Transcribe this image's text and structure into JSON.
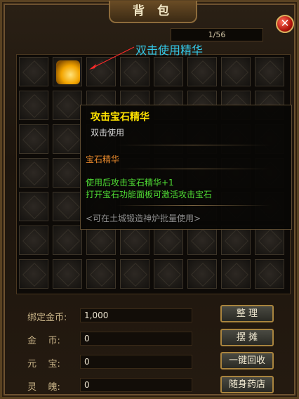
{
  "window": {
    "title": "背 包",
    "close": "✕"
  },
  "inventory": {
    "count": "1/56",
    "hint": "双击使用精华",
    "item_icon": "gem-essence-icon"
  },
  "tooltip": {
    "name": "攻击宝石精华",
    "usage": "双击使用",
    "category": "宝石精华",
    "effect_line1": "使用后攻击宝石精华+1",
    "effect_line2": "打开宝石功能面板可激活攻击宝石",
    "note": "<可在土城锻造神炉批量使用>"
  },
  "stats": {
    "bound_gold_label": "绑定金币:",
    "bound_gold_value": "1,000",
    "gold_label": "金    币:",
    "gold_value": "0",
    "yuanbao_label": "元    宝:",
    "yuanbao_value": "0",
    "soul_label": "灵    魄:",
    "soul_value": "0"
  },
  "buttons": {
    "sort": "整 理",
    "stall": "摆 摊",
    "recycle": "一键回收",
    "shop": "随身药店"
  },
  "colors": {
    "hint": "#33c8e8",
    "item_name": "#ffe200",
    "category": "#e8892b",
    "effect": "#4fdc34"
  }
}
